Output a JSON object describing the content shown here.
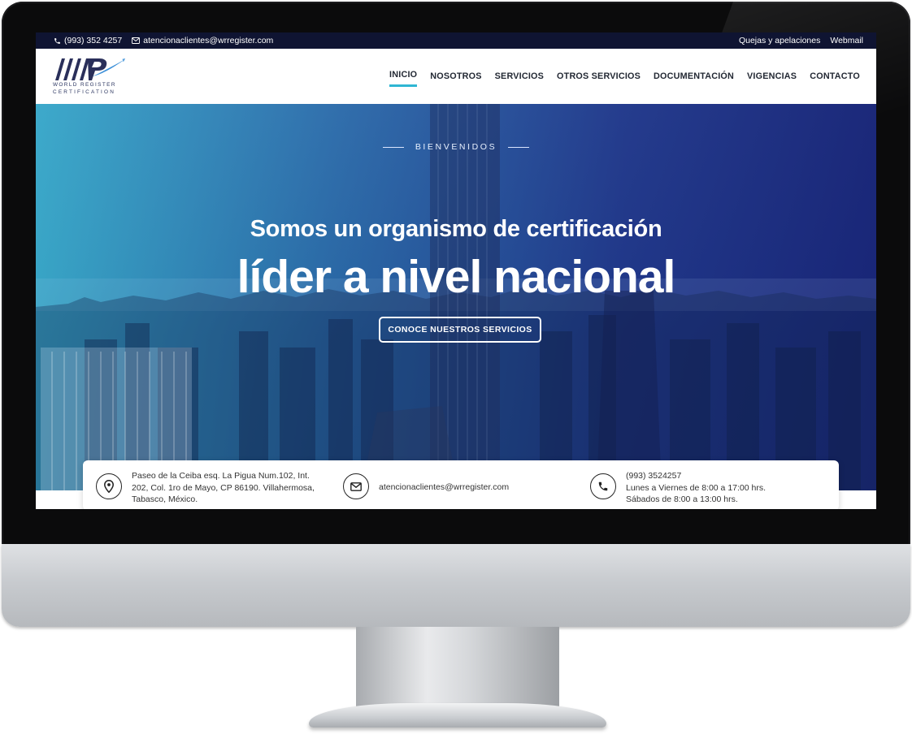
{
  "topbar": {
    "phone": "(993) 352 4257",
    "email": "atencionaclientes@wrregister.com",
    "links": [
      "Quejas y apelaciones",
      "Webmail"
    ]
  },
  "logo": {
    "line1": "WORLD REGISTER",
    "line2": "CERTIFICATION"
  },
  "nav": {
    "items": [
      "INICIO",
      "NOSOTROS",
      "SERVICIOS",
      "OTROS SERVICIOS",
      "DOCUMENTACIÓN",
      "VIGENCIAS",
      "CONTACTO"
    ],
    "active": "INICIO"
  },
  "hero": {
    "eyebrow": "BIENVENIDOS",
    "subtitle": "Somos un organismo de certificación",
    "title": "líder a nivel nacional",
    "button": "CONOCE NUESTROS SERVICIOS"
  },
  "info": {
    "address": [
      "Paseo de la Ceiba esq. La Pigua Num.102, Int.",
      "202, Col. 1ro de Mayo, CP 86190. Villahermosa,",
      "Tabasco, México."
    ],
    "email": "atencionaclientes@wrregister.com",
    "phone": [
      "(993) 3524257",
      "Lunes a Viernes de 8:00 a 17:00 hrs.",
      "Sábados de 8:00 a 13:00 hrs."
    ]
  },
  "colors": {
    "topbar": "#0f1432",
    "accent": "#2fb6d3",
    "hero_left": "#38b2d4",
    "hero_right": "#162278"
  },
  "icons": [
    "phone-icon",
    "mail-icon",
    "location-pin-icon",
    "envelope-icon",
    "phone-circle-icon"
  ]
}
